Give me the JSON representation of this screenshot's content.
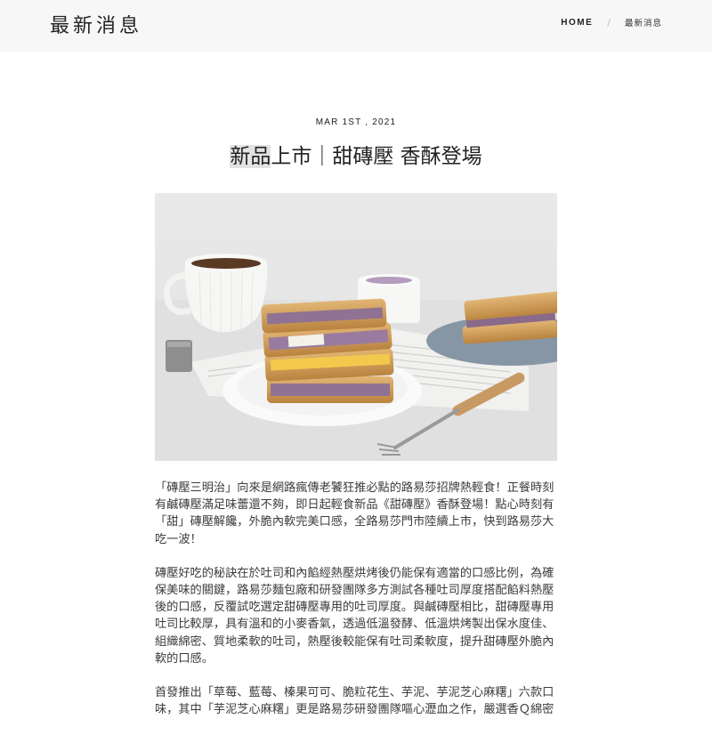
{
  "header": {
    "site_title": "最新消息",
    "nav": {
      "home": "HOME",
      "separator": "/",
      "current": "最新消息"
    }
  },
  "post": {
    "date": "MAR 1ST , 2021",
    "title_highlight": "新品",
    "title_rest": "上市｜甜磚壓 香酥登場",
    "paragraphs": [
      "「磚壓三明治」向來是網路瘋傳老饕狂推必點的路易莎招牌熱輕食！正餐時刻有鹹磚壓滿足味蕾還不夠，即日起輕食新品《甜磚壓》香酥登場！點心時刻有「甜」磚壓解饞，外脆內軟完美口感，全路易莎門市陸續上市，快到路易莎大吃一波！",
      "磚壓好吃的秘訣在於吐司和內餡經熱壓烘烤後仍能保有適當的口感比例，為確保美味的關鍵，路易莎麵包廠和研發團隊多方測試各種吐司厚度搭配餡料熱壓後的口感，反覆試吃選定甜磚壓專用的吐司厚度。與鹹磚壓相比，甜磚壓專用吐司比較厚，具有溫和的小麥香氣，透過低溫發酵、低溫烘烤製出保水度佳、組織綿密、質地柔軟的吐司，熱壓後較能保有吐司柔軟度，提升甜磚壓外脆內軟的口感。",
      "首發推出「草莓、藍莓、榛果可可、脆粒花生、芋泥、芋泥芝心麻糬」六款口味，其中「芋泥芝心麻糬」更是路易莎研發團隊嘔心瀝血之作，嚴選香Ｑ綿密"
    ]
  },
  "colors": {
    "header_bg": "#f7f7f7",
    "text": "#3c3c3c",
    "title_highlight_bg": "#e3e3e3"
  }
}
